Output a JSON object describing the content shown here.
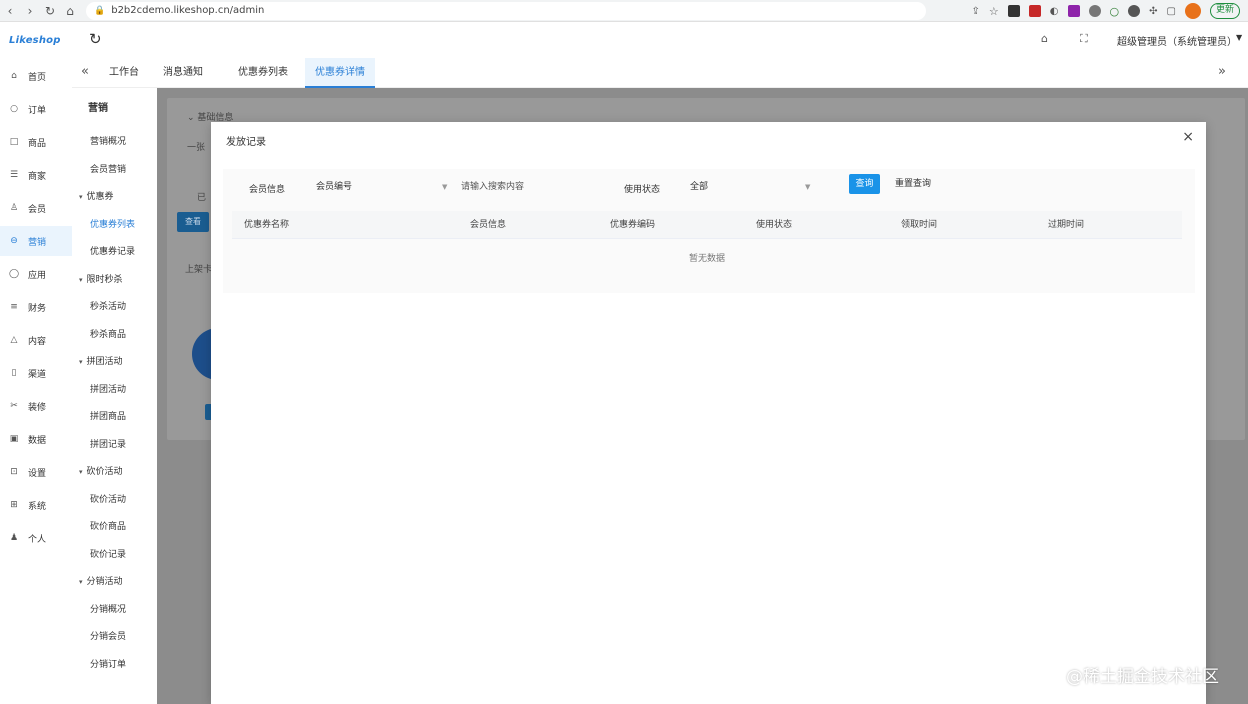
{
  "browser": {
    "url": "b2b2cdemo.likeshop.cn/admin",
    "update_label": "更新"
  },
  "app": {
    "logo": "Likeshop",
    "admin_name": "超级管理员（系统管理员）"
  },
  "tabs": [
    {
      "label": "工作台",
      "active": false
    },
    {
      "label": "消息通知",
      "active": false
    },
    {
      "label": "优惠券列表",
      "active": false
    },
    {
      "label": "优惠券详情",
      "active": true
    }
  ],
  "main_menu": [
    {
      "icon": "home-icon",
      "glyph": "⌂",
      "label": "首页",
      "active": false
    },
    {
      "icon": "order-icon",
      "glyph": "○",
      "label": "订单",
      "active": false
    },
    {
      "icon": "goods-icon",
      "glyph": "□",
      "label": "商品",
      "active": false
    },
    {
      "icon": "shop-icon",
      "glyph": "☰",
      "label": "商家",
      "active": false
    },
    {
      "icon": "user-icon",
      "glyph": "♙",
      "label": "会员",
      "active": false
    },
    {
      "icon": "marketing-icon",
      "glyph": "⊖",
      "label": "营销",
      "active": true
    },
    {
      "icon": "application-icon",
      "glyph": "◯",
      "label": "应用",
      "active": false
    },
    {
      "icon": "finance-icon",
      "glyph": "≡",
      "label": "财务",
      "active": false
    },
    {
      "icon": "content-icon",
      "glyph": "△",
      "label": "内容",
      "active": false
    },
    {
      "icon": "channel-icon",
      "glyph": "▯",
      "label": "渠道",
      "active": false
    },
    {
      "icon": "decoration-icon",
      "glyph": "✂",
      "label": "装修",
      "active": false
    },
    {
      "icon": "data-icon",
      "glyph": "▣",
      "label": "数据",
      "active": false
    },
    {
      "icon": "settings-icon",
      "glyph": "⊡",
      "label": "设置",
      "active": false
    },
    {
      "icon": "system-icon",
      "glyph": "⊞",
      "label": "系统",
      "active": false
    },
    {
      "icon": "personal-icon",
      "glyph": "♟",
      "label": "个人",
      "active": false
    }
  ],
  "sub_menu": {
    "title": "营销",
    "items": [
      {
        "type": "leaf",
        "label": "营销概况",
        "active": false
      },
      {
        "type": "leaf",
        "label": "会员营销",
        "active": false
      },
      {
        "type": "group",
        "label": "优惠券",
        "active": false
      },
      {
        "type": "leaf",
        "label": "优惠券列表",
        "active": true
      },
      {
        "type": "leaf",
        "label": "优惠券记录",
        "active": false
      },
      {
        "type": "group",
        "label": "限时秒杀",
        "active": false
      },
      {
        "type": "leaf",
        "label": "秒杀活动",
        "active": false
      },
      {
        "type": "leaf",
        "label": "秒杀商品",
        "active": false
      },
      {
        "type": "group",
        "label": "拼团活动",
        "active": false
      },
      {
        "type": "leaf",
        "label": "拼团活动",
        "active": false
      },
      {
        "type": "leaf",
        "label": "拼团商品",
        "active": false
      },
      {
        "type": "leaf",
        "label": "拼团记录",
        "active": false
      },
      {
        "type": "group",
        "label": "砍价活动",
        "active": false
      },
      {
        "type": "leaf",
        "label": "砍价活动",
        "active": false
      },
      {
        "type": "leaf",
        "label": "砍价商品",
        "active": false
      },
      {
        "type": "leaf",
        "label": "砍价记录",
        "active": false
      },
      {
        "type": "group",
        "label": "分销活动",
        "active": false
      },
      {
        "type": "leaf",
        "label": "分销概况",
        "active": false
      },
      {
        "type": "leaf",
        "label": "分销会员",
        "active": false
      },
      {
        "type": "leaf",
        "label": "分销订单",
        "active": false
      }
    ]
  },
  "background_page": {
    "section_label": "基础信息",
    "partial_text_1": "一张",
    "partial_text_2": "已",
    "edit_button": "查看",
    "partial_text_3": "上架卡"
  },
  "modal": {
    "title": "发放记录",
    "filters": {
      "member_label": "会员信息",
      "member_select": "会员编号",
      "member_placeholder": "请输入搜索内容",
      "status_label": "使用状态",
      "status_value": "全部",
      "query_button": "查询",
      "reset_button": "重置查询"
    },
    "columns": [
      "优惠券名称",
      "会员信息",
      "优惠券编码",
      "使用状态",
      "领取时间",
      "过期时间"
    ],
    "empty_text": "暂无数据"
  },
  "watermark": "@稀土掘金技术社区"
}
